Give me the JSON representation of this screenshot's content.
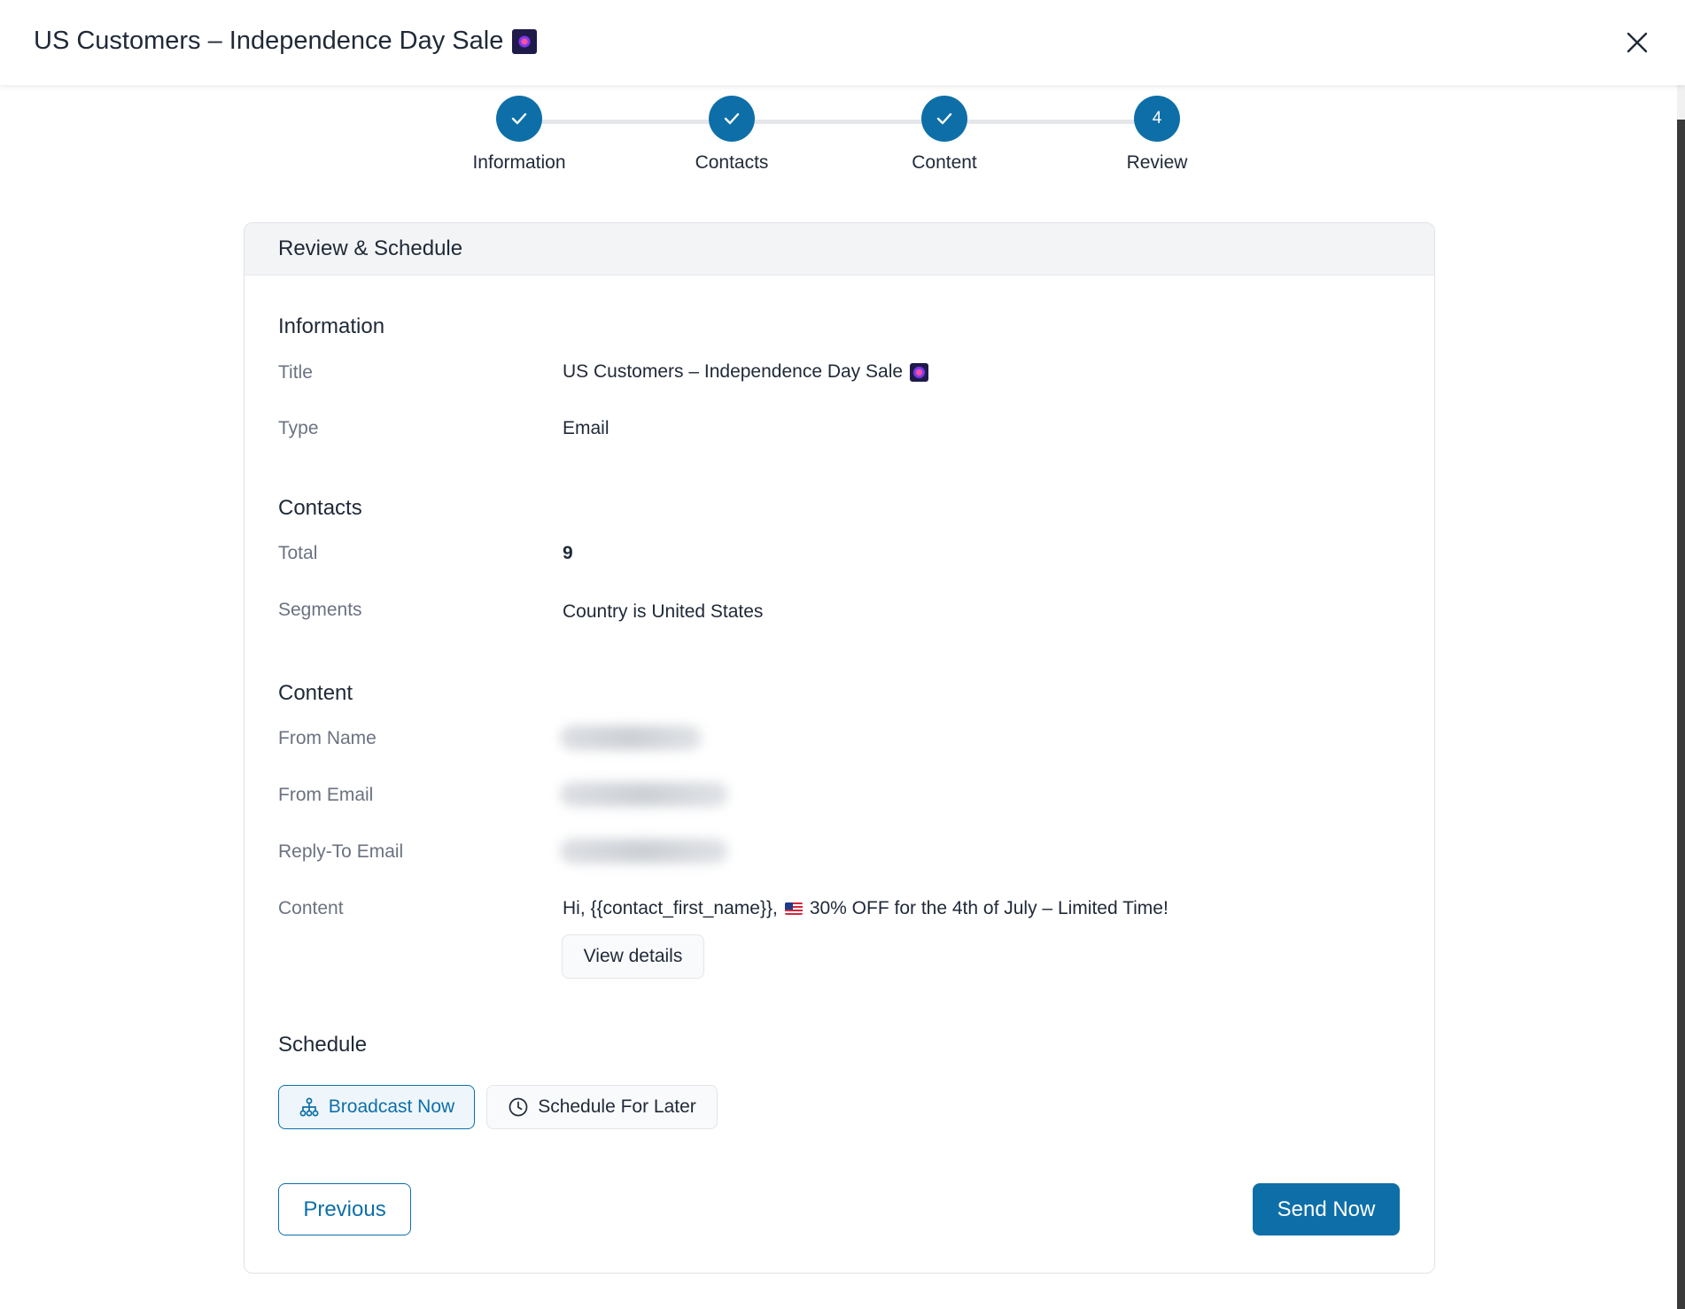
{
  "modal": {
    "title": "US Customers – Independence Day Sale",
    "title_icon": "firework-emoji",
    "close_icon": "close-icon"
  },
  "stepper": {
    "steps": [
      {
        "label": "Information",
        "state": "complete",
        "marker": "check-icon"
      },
      {
        "label": "Contacts",
        "state": "complete",
        "marker": "check-icon"
      },
      {
        "label": "Content",
        "state": "complete",
        "marker": "check-icon"
      },
      {
        "label": "Review",
        "state": "current",
        "number": "4"
      }
    ]
  },
  "card": {
    "header": "Review & Schedule",
    "information": {
      "heading": "Information",
      "title_label": "Title",
      "title_value": "US Customers – Independence Day Sale",
      "type_label": "Type",
      "type_value": "Email"
    },
    "contacts": {
      "heading": "Contacts",
      "total_label": "Total",
      "total_value": "9",
      "segments_label": "Segments",
      "segments_value": "Country is United States"
    },
    "content": {
      "heading": "Content",
      "from_name_label": "From Name",
      "from_email_label": "From Email",
      "reply_to_label": "Reply-To Email",
      "content_label": "Content",
      "content_prefix": "Hi, {{contact_first_name}},",
      "content_suffix": "30% OFF for the 4th of July – Limited Time!",
      "view_details": "View details"
    },
    "schedule": {
      "heading": "Schedule",
      "broadcast_now": "Broadcast Now",
      "schedule_later": "Schedule For Later",
      "selected": "Broadcast Now"
    },
    "footer": {
      "previous": "Previous",
      "send_now": "Send Now"
    }
  },
  "colors": {
    "primary": "#0e6fa8",
    "muted_text": "#6b7280",
    "text": "#1f2937"
  }
}
